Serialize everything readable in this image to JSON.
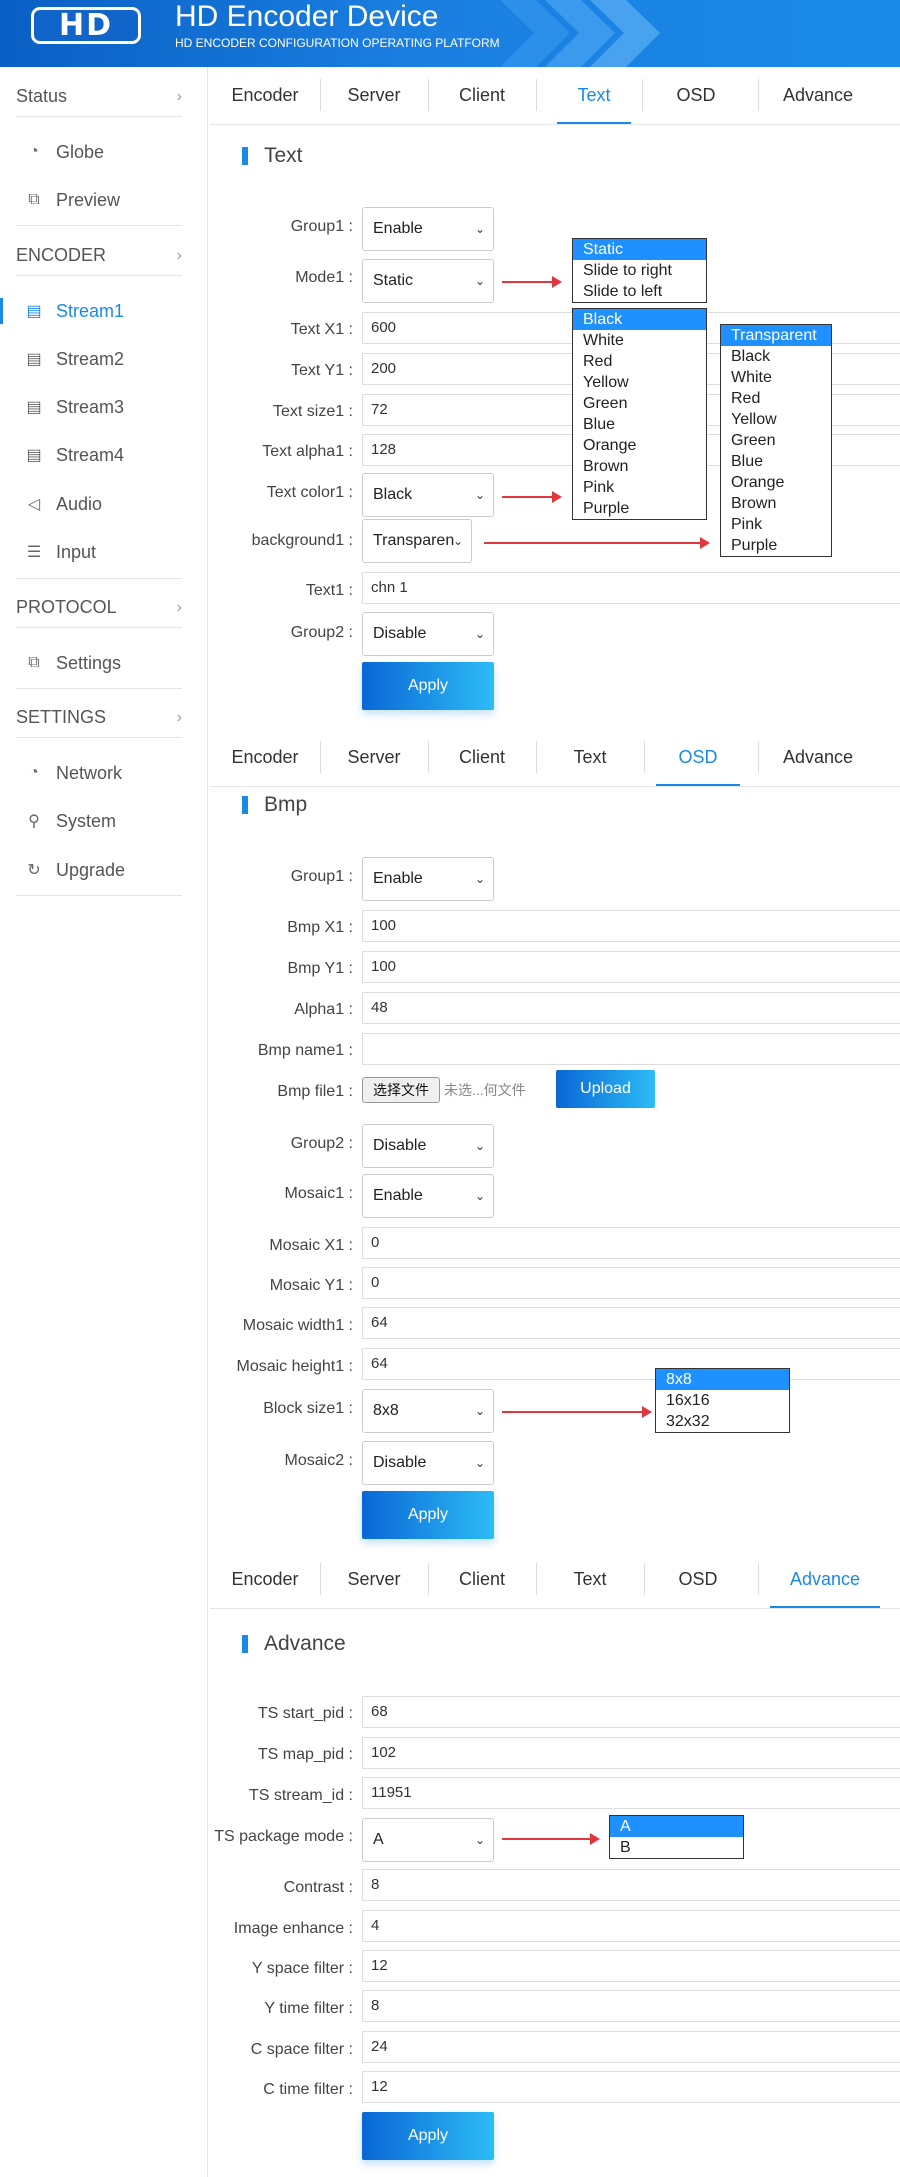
{
  "header": {
    "logo_text": "HD",
    "title": "HD Encoder Device",
    "subtitle": "HD ENCODER CONFIGURATION OPERATING PLATFORM"
  },
  "sidebar": {
    "sections": [
      {
        "label": "Status",
        "items": [
          {
            "label": "Globe",
            "icon": "globe-icon"
          },
          {
            "label": "Preview",
            "icon": "preview-icon"
          }
        ]
      },
      {
        "label": "ENCODER",
        "items": [
          {
            "label": "Stream1",
            "icon": "stream-icon",
            "active": true
          },
          {
            "label": "Stream2",
            "icon": "stream-icon"
          },
          {
            "label": "Stream3",
            "icon": "stream-icon"
          },
          {
            "label": "Stream4",
            "icon": "stream-icon"
          },
          {
            "label": "Audio",
            "icon": "audio-icon"
          },
          {
            "label": "Input",
            "icon": "input-icon"
          }
        ]
      },
      {
        "label": "PROTOCOL",
        "items": [
          {
            "label": "Settings",
            "icon": "settings-icon"
          }
        ]
      },
      {
        "label": "SETTINGS",
        "items": [
          {
            "label": "Network",
            "icon": "network-icon"
          },
          {
            "label": "System",
            "icon": "user-icon"
          },
          {
            "label": "Upgrade",
            "icon": "refresh-icon"
          }
        ]
      }
    ]
  },
  "tabs": [
    "Encoder",
    "Server",
    "Client",
    "Text",
    "OSD",
    "Advance"
  ],
  "text_panel": {
    "active_tab": "Text",
    "title": "Text",
    "group1_label": "Group1 :",
    "group1_value": "Enable",
    "mode1_label": "Mode1 :",
    "mode1_value": "Static",
    "x1_label": "Text X1 :",
    "x1_value": "600",
    "y1_label": "Text Y1 :",
    "y1_value": "200",
    "size1_label": "Text size1 :",
    "size1_value": "72",
    "alpha1_label": "Text alpha1 :",
    "alpha1_value": "128",
    "color1_label": "Text color1 :",
    "color1_value": "Black",
    "bg1_label": "background1 :",
    "bg1_value": "Transparen",
    "text1_label": "Text1 :",
    "text1_value": "chn 1",
    "group2_label": "Group2 :",
    "group2_value": "Disable",
    "apply_label": "Apply",
    "mode_options": [
      "Static",
      "Slide to right",
      "Slide to left"
    ],
    "color_options": [
      "Black",
      "White",
      "Red",
      "Yellow",
      "Green",
      "Blue",
      "Orange",
      "Brown",
      "Pink",
      "Purple"
    ],
    "bg_options": [
      "Transparent",
      "Black",
      "White",
      "Red",
      "Yellow",
      "Green",
      "Blue",
      "Orange",
      "Brown",
      "Pink",
      "Purple"
    ]
  },
  "osd_panel": {
    "active_tab": "OSD",
    "title": "Bmp",
    "group1_label": "Group1 :",
    "group1_value": "Enable",
    "bx1_label": "Bmp X1 :",
    "bx1_value": "100",
    "by1_label": "Bmp Y1 :",
    "by1_value": "100",
    "alpha1_label": "Alpha1 :",
    "alpha1_value": "48",
    "bname1_label": "Bmp name1 :",
    "bname1_value": "",
    "bfile1_label": "Bmp file1 :",
    "file_button": "选择文件",
    "file_status": "未选...何文件",
    "upload_label": "Upload",
    "group2_label": "Group2 :",
    "group2_value": "Disable",
    "mosaic1_label": "Mosaic1 :",
    "mosaic1_value": "Enable",
    "mx1_label": "Mosaic X1 :",
    "mx1_value": "0",
    "my1_label": "Mosaic Y1 :",
    "my1_value": "0",
    "mw1_label": "Mosaic width1 :",
    "mw1_value": "64",
    "mh1_label": "Mosaic height1 :",
    "mh1_value": "64",
    "block1_label": "Block size1 :",
    "block1_value": "8x8",
    "mosaic2_label": "Mosaic2 :",
    "mosaic2_value": "Disable",
    "apply_label": "Apply",
    "block_options": [
      "8x8",
      "16x16",
      "32x32"
    ]
  },
  "advance_panel": {
    "active_tab": "Advance",
    "title": "Advance",
    "start_pid_label": "TS start_pid :",
    "start_pid_value": "68",
    "map_pid_label": "TS map_pid :",
    "map_pid_value": "102",
    "stream_id_label": "TS stream_id :",
    "stream_id_value": "11951",
    "pkg_mode_label": "TS package mode :",
    "pkg_mode_value": "A",
    "contrast_label": "Contrast :",
    "contrast_value": "8",
    "enhance_label": "Image enhance :",
    "enhance_value": "4",
    "yspace_label": "Y space filter :",
    "yspace_value": "12",
    "ytime_label": "Y time filter :",
    "ytime_value": "8",
    "cspace_label": "C space filter :",
    "cspace_value": "24",
    "ctime_label": "C time filter :",
    "ctime_value": "12",
    "apply_label": "Apply",
    "pkg_options": [
      "A",
      "B"
    ]
  },
  "colors": {
    "accent": "#1a8ae8",
    "header_start": "#0a5fc4",
    "arrow": "#e0373f",
    "highlight": "#1e90ff"
  }
}
